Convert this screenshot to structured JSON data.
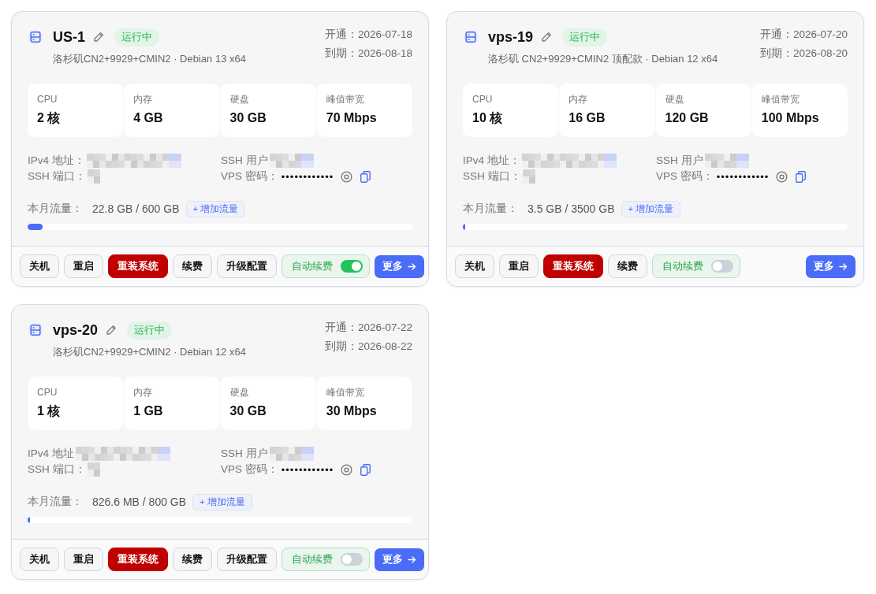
{
  "servers": [
    {
      "name": "US-1",
      "status": "运行中",
      "plan": "洛杉矶CN2+9929+CMIN2 · Debian 13 x64",
      "dates": [
        "开通：2026-07-18",
        "到期：2026-08-18"
      ],
      "specs": [
        {
          "label": "CPU",
          "value": "2 核"
        },
        {
          "label": "内存",
          "value": "4 GB"
        },
        {
          "label": "硬盘",
          "value": "30 GB"
        },
        {
          "label": "峰值带宽",
          "value": "70 Mbps"
        }
      ],
      "access": {
        "ip_label": "IPv4 地址：",
        "user_label": "SSH 用户",
        "port_label": "SSH 端口：",
        "password_label": "VPS 密码：",
        "password": "••••••••••••"
      },
      "traffic": {
        "label": "本月流量：",
        "value": "22.8 GB / 600 GB",
        "add_button": "+ 增加流量",
        "level": 0.038
      },
      "actions": [
        {
          "label": "关机",
          "kind": "normal"
        },
        {
          "label": "重启",
          "kind": "normal"
        },
        {
          "label": "重装系统",
          "kind": "danger"
        },
        {
          "label": "续费",
          "kind": "normal"
        },
        {
          "label": "升级配置",
          "kind": "normal"
        }
      ],
      "auto_renew": {
        "label": "自动续费",
        "on": true
      },
      "more": "更多"
    },
    {
      "name": "vps-19",
      "status": "运行中",
      "plan": "洛杉矶 CN2+9929+CMIN2 顶配款 · Debian 12 x64",
      "dates": [
        "开通：2026-07-20",
        "到期：2026-08-20"
      ],
      "specs": [
        {
          "label": "CPU",
          "value": "10 核"
        },
        {
          "label": "内存",
          "value": "16 GB"
        },
        {
          "label": "硬盘",
          "value": "120 GB"
        },
        {
          "label": "峰值带宽",
          "value": "100 Mbps"
        }
      ],
      "access": {
        "ip_label": "IPv4 地址：",
        "user_label": "SSH 用户",
        "port_label": "SSH 端口：",
        "password_label": "VPS 密码：",
        "password": "••••••••••••"
      },
      "traffic": {
        "label": "本月流量：",
        "value": "3.5 GB / 3500 GB",
        "add_button": "+ 增加流量",
        "level": 0.001
      },
      "actions": [
        {
          "label": "关机",
          "kind": "normal"
        },
        {
          "label": "重启",
          "kind": "normal"
        },
        {
          "label": "重装系统",
          "kind": "danger"
        },
        {
          "label": "续费",
          "kind": "normal"
        }
      ],
      "auto_renew": {
        "label": "自动续费",
        "on": false
      },
      "more": "更多"
    },
    {
      "name": "vps-20",
      "status": "运行中",
      "plan": "洛杉矶CN2+9929+CMIN2 · Debian 12 x64",
      "dates": [
        "开通：2026-07-22",
        "到期：2026-08-22"
      ],
      "specs": [
        {
          "label": "CPU",
          "value": "1 核"
        },
        {
          "label": "内存",
          "value": "1 GB"
        },
        {
          "label": "硬盘",
          "value": "30 GB"
        },
        {
          "label": "峰值带宽",
          "value": "30 Mbps"
        }
      ],
      "access": {
        "ip_label": "IPv4 地址",
        "user_label": "SSH 用户",
        "port_label": "SSH 端口：",
        "password_label": "VPS 密码：",
        "password": "••••••••••••"
      },
      "traffic": {
        "label": "本月流量：",
        "value": "826.6 MB / 800 GB",
        "add_button": "+ 增加流量",
        "level": 0.001
      },
      "actions": [
        {
          "label": "关机",
          "kind": "normal"
        },
        {
          "label": "重启",
          "kind": "normal"
        },
        {
          "label": "重装系统",
          "kind": "danger"
        },
        {
          "label": "续费",
          "kind": "normal"
        },
        {
          "label": "升级配置",
          "kind": "normal"
        }
      ],
      "auto_renew": {
        "label": "自动续费",
        "on": false
      },
      "more": "更多"
    }
  ]
}
